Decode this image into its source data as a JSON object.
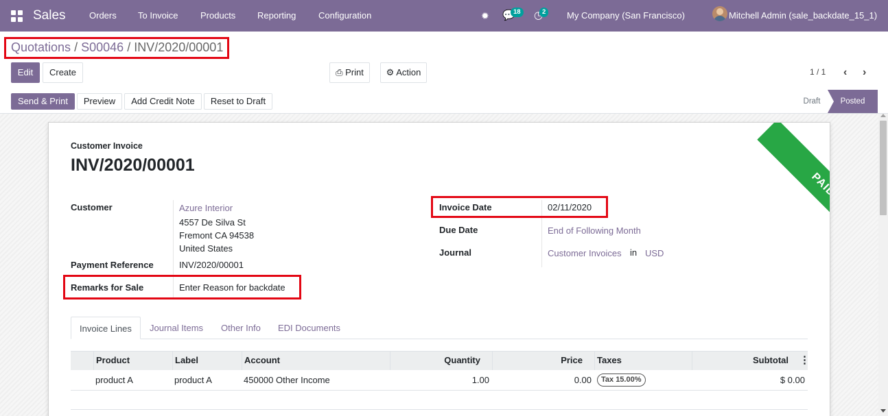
{
  "nav": {
    "app_name": "Sales",
    "menu": [
      "Orders",
      "To Invoice",
      "Products",
      "Reporting",
      "Configuration"
    ],
    "messages_badge": "18",
    "activity_badge": "2",
    "company": "My Company (San Francisco)",
    "user": "Mitchell Admin (sale_backdate_15_1)"
  },
  "breadcrumb": {
    "items": [
      "Quotations",
      "S00046"
    ],
    "current": "INV/2020/00001",
    "separator": "/"
  },
  "toolbar": {
    "edit": "Edit",
    "create": "Create",
    "print": "Print",
    "action": "Action",
    "pager": "1 / 1"
  },
  "statusbar": {
    "buttons": [
      "Send & Print",
      "Preview",
      "Add Credit Note",
      "Reset to Draft"
    ],
    "stages": [
      "Draft",
      "Posted"
    ],
    "active_stage": "Posted"
  },
  "invoice": {
    "type_label": "Customer Invoice",
    "number": "INV/2020/00001",
    "ribbon": "PAID",
    "customer_label": "Customer",
    "customer_name": "Azure Interior",
    "address": [
      "4557 De Silva St",
      "Fremont CA 94538",
      "United States"
    ],
    "payment_ref_label": "Payment Reference",
    "payment_ref": "INV/2020/00001",
    "remarks_label": "Remarks for Sale",
    "remarks": "Enter Reason for backdate",
    "invoice_date_label": "Invoice Date",
    "invoice_date": "02/11/2020",
    "due_date_label": "Due Date",
    "due_date": "End of Following Month",
    "journal_label": "Journal",
    "journal": "Customer Invoices",
    "journal_in": "in",
    "currency": "USD"
  },
  "tabs": [
    "Invoice Lines",
    "Journal Items",
    "Other Info",
    "EDI Documents"
  ],
  "lines": {
    "headers": [
      "Product",
      "Label",
      "Account",
      "Quantity",
      "Price",
      "Taxes",
      "Subtotal"
    ],
    "rows": [
      {
        "product": "product A",
        "label": "product A",
        "account": "450000 Other Income",
        "quantity": "1.00",
        "price": "0.00",
        "taxes": "Tax 15.00%",
        "subtotal": "$ 0.00"
      }
    ]
  },
  "colors": {
    "brand": "#7c6b96",
    "paid_ribbon": "#28a745",
    "highlight": "#e30613",
    "badge": "#00a09d"
  }
}
